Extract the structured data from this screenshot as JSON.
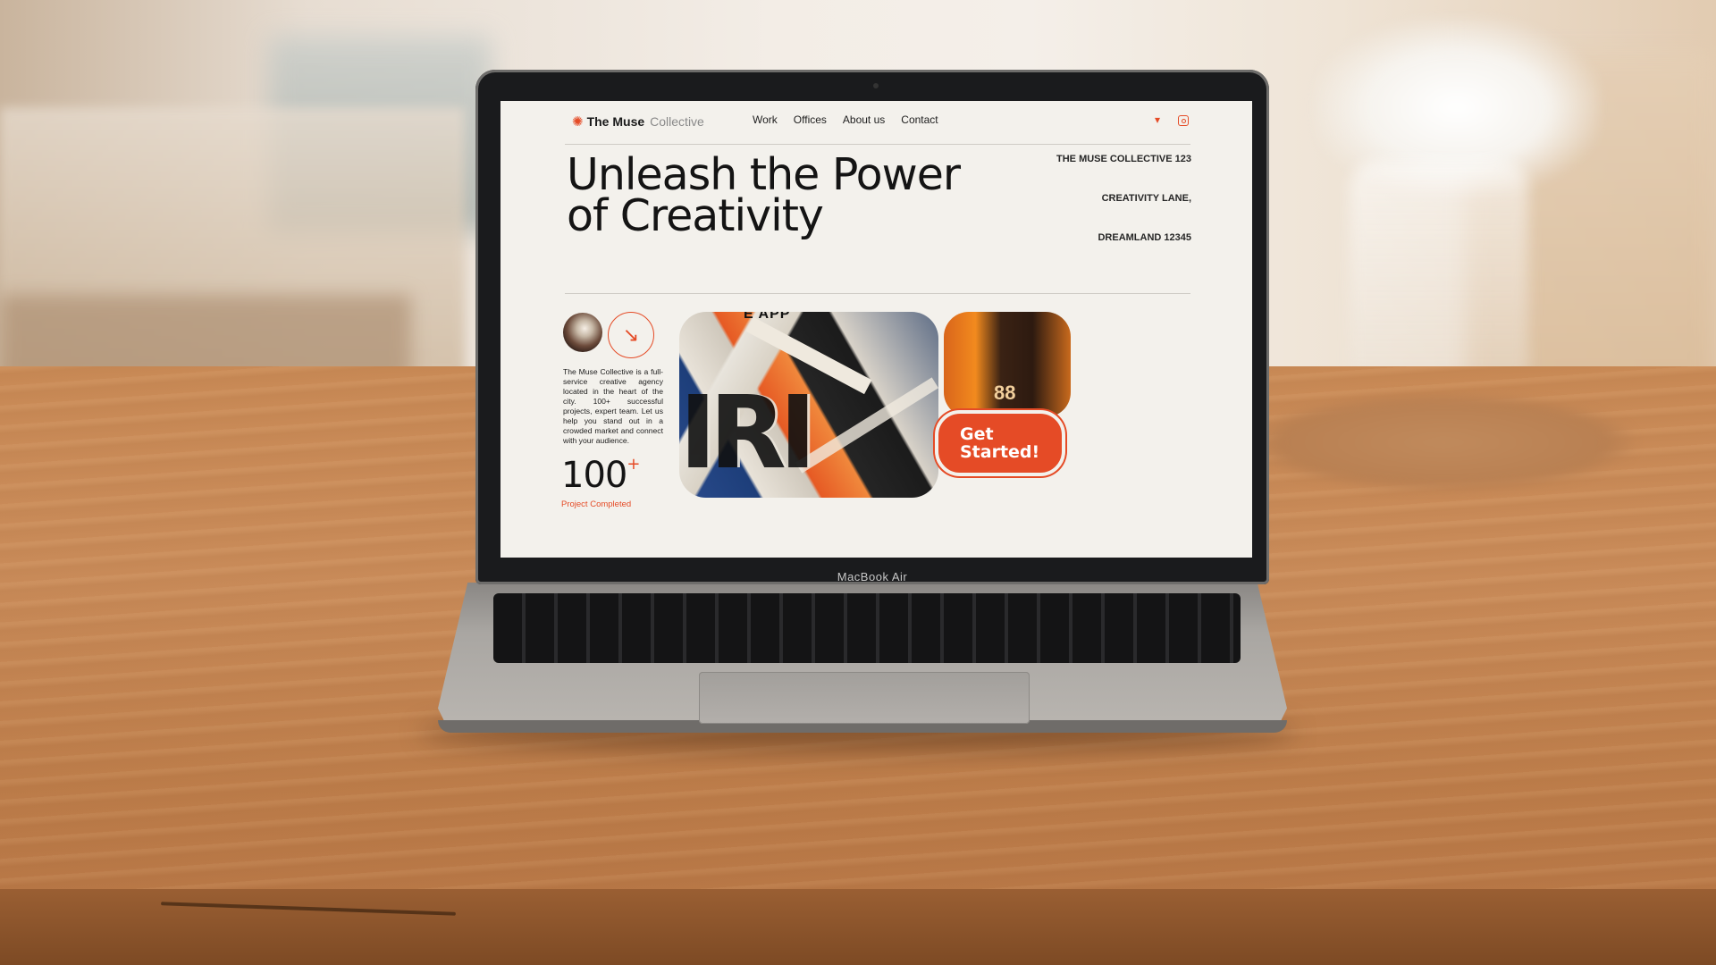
{
  "site": {
    "brand": {
      "name": "The Muse",
      "suffix": "Collective",
      "mark_icon": "sun-flower-icon"
    },
    "nav": [
      "Work",
      "Offices",
      "About us",
      "Contact"
    ],
    "social": [
      {
        "icon": "twitter-icon",
        "glyph": "🐦"
      },
      {
        "icon": "instagram-icon",
        "glyph": ""
      }
    ],
    "headline": "Unleash the Power of Creativity",
    "address": [
      "THE MUSE COLLECTIVE 123",
      "CREATIVITY LANE,",
      "DREAMLAND 12345"
    ],
    "arrow_glyph": "↘",
    "blurb": "The Muse Collective is a full-service creative agency located in the heart of the city. 100+ successful projects, expert team. Let us help you stand out in a crowded market and connect with your audience.",
    "stat": {
      "value": "100",
      "sup": "+",
      "label": "Project Completed"
    },
    "cta": "Get\nStarted!",
    "collage_text": "IRI",
    "collage_top": "E APP",
    "collage_digits": "88"
  },
  "device": {
    "label": "MacBook Air"
  },
  "colors": {
    "accent": "#e54b26",
    "page_bg": "#f3f1ec",
    "text": "#141414"
  }
}
